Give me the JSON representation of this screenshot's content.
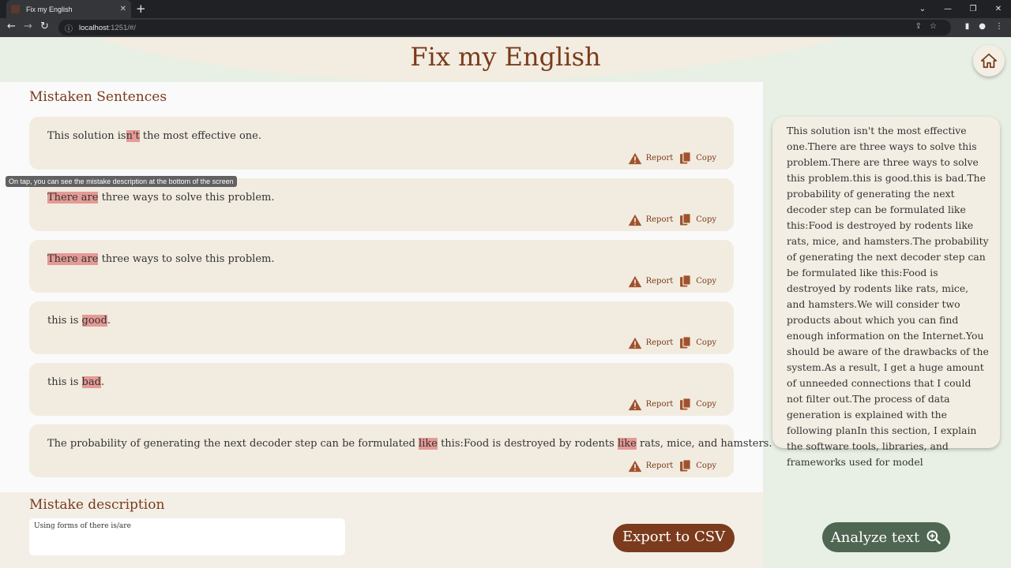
{
  "browser": {
    "tab_title": "Fix my English",
    "url_host": "localhost",
    "url_rest": ":1251/#/"
  },
  "app": {
    "title": "Fix my English"
  },
  "mistakes": {
    "section_title": "Mistaken Sentences",
    "report_label": "Report",
    "copy_label": "Copy",
    "items": [
      {
        "before": "This solution is",
        "hl1": "n't",
        "middle": " the most effective one.",
        "hl2": "",
        "after": ""
      },
      {
        "before": "",
        "hl1": "There are",
        "middle": " three ways to solve this problem.",
        "hl2": "",
        "after": ""
      },
      {
        "before": "",
        "hl1": "There are",
        "middle": " three ways to solve this problem.",
        "hl2": "",
        "after": ""
      },
      {
        "before": "this is ",
        "hl1": "good",
        "middle": ".",
        "hl2": "",
        "after": ""
      },
      {
        "before": "this is ",
        "hl1": "bad",
        "middle": ".",
        "hl2": "",
        "after": ""
      },
      {
        "before": "The probability of generating the next decoder step can be formulated ",
        "hl1": "like",
        "middle": " this:Food is destroyed by rodents ",
        "hl2": "like",
        "after": " rats, mice, and hamsters."
      }
    ]
  },
  "tooltip": "On tap, you can see the mistake description at the bottom of the screen",
  "description": {
    "section_title": "Mistake description",
    "text": "Using forms of there is/are"
  },
  "export_label": "Export to CSV",
  "analysis_text": "This solution isn't the most effective one.There are three ways to solve this problem.There are three ways to solve this problem.this is good.this is bad.The probability of generating the next decoder step can be formulated like this:Food is destroyed by rodents like rats, mice, and hamsters.The probability of generating the next decoder step can be formulated like this:Food is destroyed by rodents like rats, mice, and hamsters.We will consider two products about which you can find enough information on the Internet.You should be aware of the drawbacks of the system.As a result, I get a huge amount of unneeded connections that I could not filter out.The process of data generation is explained with the following planIn this section, I explain the software tools, libraries, and frameworks used for model",
  "analyze_label": "Analyze text",
  "colors": {
    "accent_brown": "#7b3b1c",
    "highlight": "#e49a95",
    "analyze_green": "#4e6652",
    "card_bg": "#f2ece0"
  }
}
